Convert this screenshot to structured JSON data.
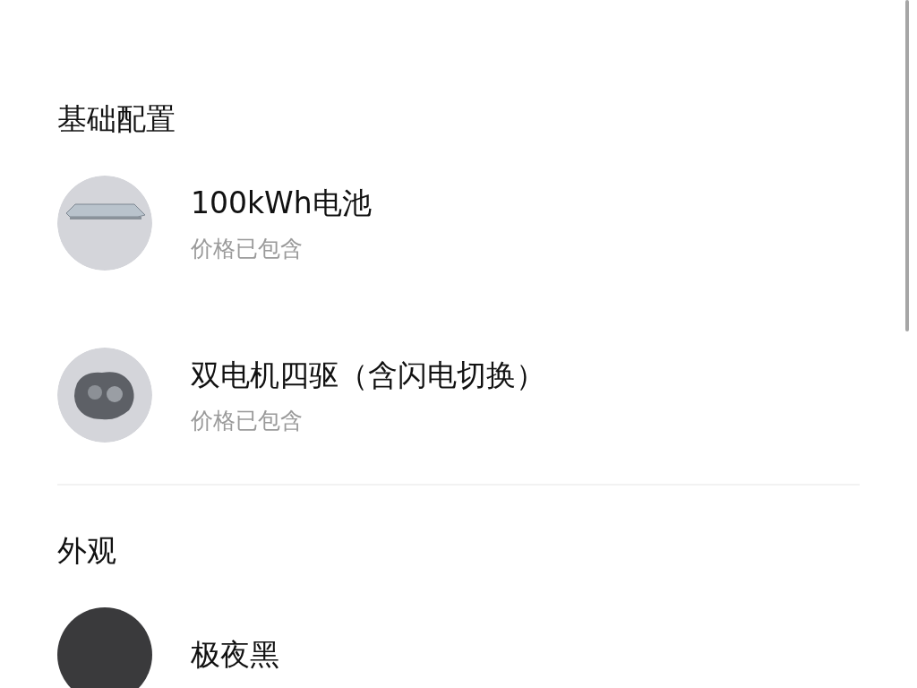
{
  "sections": [
    {
      "title": "基础配置",
      "items": [
        {
          "kind": "battery",
          "name": "100kWh电池",
          "note": "价格已包含"
        },
        {
          "kind": "motor",
          "name": "双电机四驱（含闪电切换）",
          "note": "价格已包含"
        }
      ]
    },
    {
      "title": "外观",
      "items": [
        {
          "kind": "swatch",
          "color": "#3a3a3c",
          "name": "极夜黑"
        }
      ]
    }
  ]
}
